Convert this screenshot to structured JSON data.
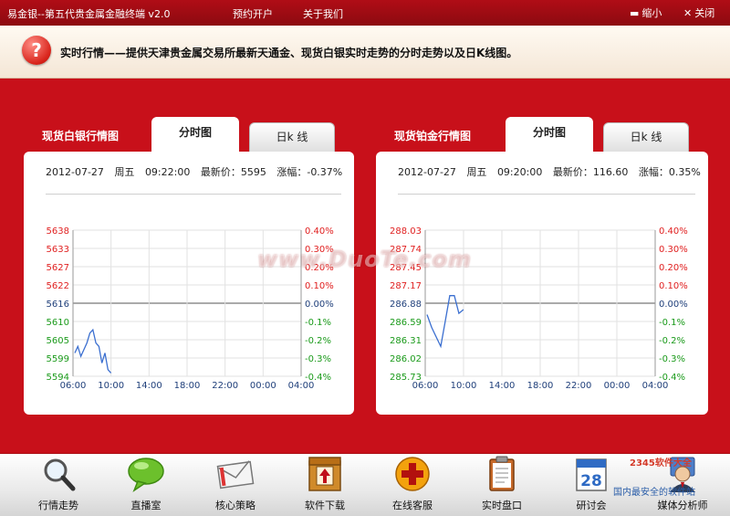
{
  "app": {
    "title": "易金银--第五代贵金属金融终端  v2.0",
    "nav": [
      "预约开户",
      "关于我们"
    ],
    "minimize_label": "缩小",
    "close_label": "关闭"
  },
  "banner": {
    "icon": "question-icon",
    "text": "实时行情——提供天津贵金属交易所最新天通金、现货白银实时走势的分时走势以及日K线图。"
  },
  "panels": [
    {
      "label": "现货白银行情图",
      "tabs": [
        {
          "label": "分时图",
          "active": true
        },
        {
          "label": "日k 线",
          "active": false
        }
      ],
      "date": "2012-07-27",
      "weekday": "周五",
      "time": "09:22:00",
      "latest_label": "最新价：",
      "latest": "5595",
      "change_label": "涨幅：",
      "change": "-0.37%"
    },
    {
      "label": "现货铂金行情图",
      "tabs": [
        {
          "label": "分时图",
          "active": true
        },
        {
          "label": "日k 线",
          "active": false
        }
      ],
      "date": "2012-07-27",
      "weekday": "周五",
      "time": "09:20:00",
      "latest_label": "最新价：",
      "latest": "116.60",
      "change_label": "涨幅：",
      "change": "0.35%"
    }
  ],
  "chart_data": [
    {
      "type": "line",
      "x_ticks": [
        "06:00",
        "10:00",
        "14:00",
        "18:00",
        "22:00",
        "00:00",
        "04:00"
      ],
      "y_left": [
        "5638",
        "5633",
        "5627",
        "5622",
        "5616",
        "5610",
        "5605",
        "5599",
        "5594"
      ],
      "y_right": [
        "0.40%",
        "0.30%",
        "0.20%",
        "0.10%",
        "0.00%",
        "-0.1%",
        "-0.2%",
        "-0.3%",
        "-0.4%"
      ],
      "ylim": [
        5594,
        5638
      ],
      "baseline": 5616,
      "series": [
        {
          "values": [
            5601,
            5603,
            5600,
            5602,
            5604,
            5607,
            5608,
            5604,
            5603,
            5598,
            5601,
            5596,
            5595
          ]
        }
      ],
      "colors": {
        "up": "#e02020",
        "base": "#1f3f7a",
        "down": "#1a9a1a",
        "line": "#3b6fd0"
      }
    },
    {
      "type": "line",
      "x_ticks": [
        "06:00",
        "10:00",
        "14:00",
        "18:00",
        "22:00",
        "00:00",
        "04:00"
      ],
      "y_left": [
        "288.03",
        "287.74",
        "287.45",
        "287.17",
        "286.88",
        "286.59",
        "286.31",
        "286.02",
        "285.73"
      ],
      "y_right": [
        "0.40%",
        "0.30%",
        "0.20%",
        "0.10%",
        "0.00%",
        "-0.1%",
        "-0.2%",
        "-0.3%",
        "-0.4%"
      ],
      "ylim": [
        285.73,
        288.03
      ],
      "baseline": 286.88,
      "series": [
        {
          "values": [
            286.7,
            286.5,
            286.35,
            286.2,
            286.6,
            287.0,
            287.0,
            286.72,
            286.78
          ]
        }
      ],
      "colors": {
        "up": "#e02020",
        "base": "#1f3f7a",
        "down": "#1a9a1a",
        "line": "#3b6fd0"
      }
    }
  ],
  "watermark": "www.DuoTe.com",
  "toolbar": [
    {
      "label": "行情走势",
      "icon": "magnifier-icon"
    },
    {
      "label": "直播室",
      "icon": "chat-bubble-icon"
    },
    {
      "label": "核心策略",
      "icon": "envelope-icon"
    },
    {
      "label": "软件下载",
      "icon": "download-box-icon"
    },
    {
      "label": "在线客服",
      "icon": "plus-circle-icon"
    },
    {
      "label": "实时盘口",
      "icon": "clipboard-icon"
    },
    {
      "label": "研讨会",
      "icon": "calendar-icon",
      "day": "28"
    },
    {
      "label": "媒体分析师",
      "icon": "analyst-icon"
    }
  ],
  "badge": "2345软件大全",
  "badge2": "国内最安全的软件站"
}
